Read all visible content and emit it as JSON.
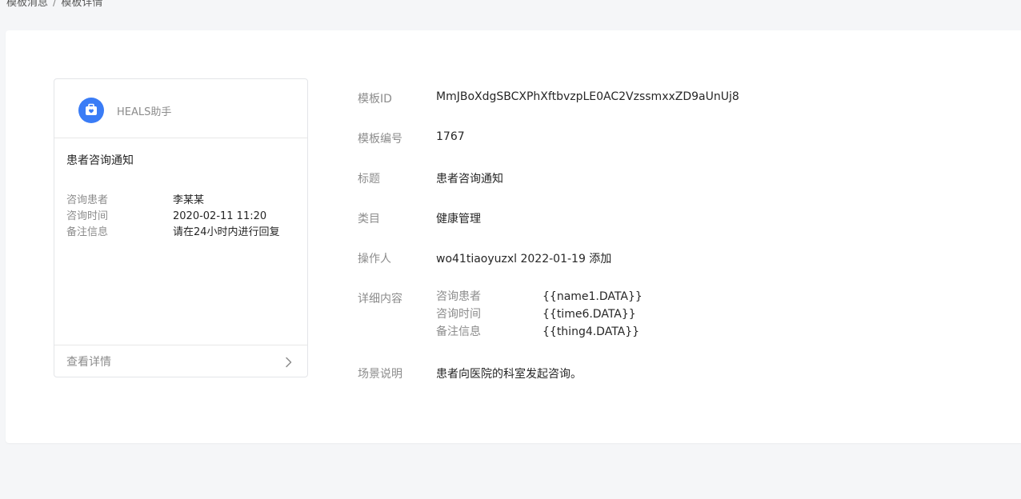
{
  "breadcrumb": {
    "parent": "模板消息",
    "current": "模板详情"
  },
  "preview": {
    "brand_icon": "medical-bag-icon",
    "brand_name": "HEALS助手",
    "title": "患者咨询通知",
    "fields": [
      {
        "label": "咨询患者",
        "value": "李某某"
      },
      {
        "label": "咨询时间",
        "value": "2020-02-11 11:20"
      },
      {
        "label": "备注信息",
        "value": "请在24小时内进行回复"
      }
    ],
    "footer_label": "查看详情",
    "footer_icon": "chevron-right-icon"
  },
  "details": {
    "template_id": {
      "label": "模板ID",
      "value": "MmJBoXdgSBCXPhXftbvzpLE0AC2VzssmxxZD9aUnUj8"
    },
    "template_no": {
      "label": "模板编号",
      "value": "1767"
    },
    "title": {
      "label": "标题",
      "value": "患者咨询通知"
    },
    "category": {
      "label": "类目",
      "value": "健康管理"
    },
    "operator": {
      "label": "操作人",
      "value": "wo41tiaoyuzxl 2022-01-19 添加"
    },
    "content": {
      "label": "详细内容",
      "items": [
        {
          "label": "咨询患者",
          "value": "{{name1.DATA}}"
        },
        {
          "label": "咨询时间",
          "value": "{{time6.DATA}}"
        },
        {
          "label": "备注信息",
          "value": "{{thing4.DATA}}"
        }
      ]
    },
    "scene": {
      "label": "场景说明",
      "value": "患者向医院的科室发起咨询。"
    }
  },
  "colors": {
    "accent": "#3a7cf6",
    "page_bg": "#f5f6f8",
    "label": "#8c8c8c",
    "text": "#262626"
  }
}
